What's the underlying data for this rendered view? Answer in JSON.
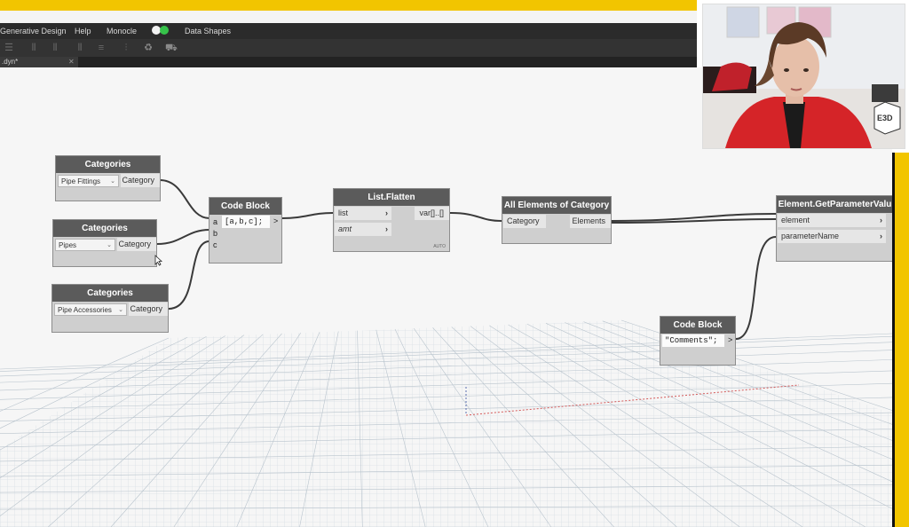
{
  "menu": {
    "items": [
      "Generative Design",
      "Help",
      "Monocle",
      "Data Shapes"
    ]
  },
  "tab": {
    "label": ".dyn*",
    "close": "✕"
  },
  "nodes": {
    "cat1": {
      "title": "Categories",
      "value": "Pipe Fittings",
      "output": "Category"
    },
    "cat2": {
      "title": "Categories",
      "value": "Pipes",
      "output": "Category"
    },
    "cat3": {
      "title": "Categories",
      "value": "Pipe Accessories",
      "output": "Category"
    },
    "code1": {
      "title": "Code Block",
      "inputs": [
        "a",
        "b",
        "c"
      ],
      "code": "[a,b,c];",
      "output": ">"
    },
    "flatten": {
      "title": "List.Flatten",
      "inputs": [
        "list",
        "amt"
      ],
      "output": "var[]..[]",
      "lacing": "AUTO"
    },
    "allelem": {
      "title": "All Elements of Category",
      "input": "Category",
      "output": "Elements"
    },
    "getparam": {
      "title": "Element.GetParameterValu",
      "inputs": [
        "element",
        "parameterName"
      ]
    },
    "code2": {
      "title": "Code Block",
      "code": "\"Comments\";",
      "output": ">"
    }
  },
  "webcam": {
    "logo": "E3D"
  },
  "colors": {
    "accent": "#f2c500",
    "node_header": "#5b5b5b",
    "node_body": "#cfcfcf",
    "wire": "#3a3a3a"
  }
}
